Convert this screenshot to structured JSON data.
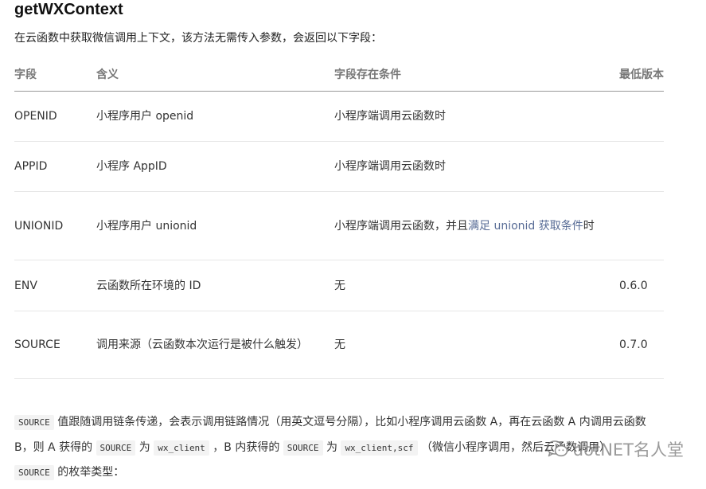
{
  "title": "getWXContext",
  "intro": "在云函数中获取微信调用上下文，该方法无需传入参数，会返回以下字段：",
  "table": {
    "headers": {
      "field": "字段",
      "meaning": "含义",
      "condition": "字段存在条件",
      "min_version": "最低版本"
    },
    "rows": [
      {
        "field": "OPENID",
        "meaning": "小程序用户 openid",
        "condition": "小程序端调用云函数时",
        "min_version": ""
      },
      {
        "field": "APPID",
        "meaning": "小程序 AppID",
        "condition": "小程序端调用云函数时",
        "min_version": ""
      },
      {
        "field": "UNIONID",
        "meaning": "小程序用户 unionid",
        "condition_prefix": "小程序端调用云函数，并且",
        "condition_link": "满足 unionid 获取条件",
        "condition_suffix": "时",
        "min_version": ""
      },
      {
        "field": "ENV",
        "meaning": "云函数所在环境的 ID",
        "condition": "无",
        "min_version": "0.6.0"
      },
      {
        "field": "SOURCE",
        "meaning": "调用来源（云函数本次运行是被什么触发）",
        "condition": "无",
        "min_version": "0.7.0"
      }
    ]
  },
  "paragraph": {
    "line1_code": "SOURCE",
    "line1_text": " 值跟随调用链条传递，会表示调用链路情况（用英文逗号分隔），比如小程序调用云函数 A，再在云函数 A 内调用云函数",
    "line2_text1": "B，则 A 获得的 ",
    "line2_code1": "SOURCE",
    "line2_text2": " 为 ",
    "line2_code2": "wx_client",
    "line2_text3": " ，B 内获得的 ",
    "line2_code3": "SOURCE",
    "line2_text4": " 为 ",
    "line2_code4": "wx_client,scf",
    "line2_text5": " （微信小程序调用，然后云函数调用）",
    "line3_code": "SOURCE",
    "line3_text": " 的枚举类型："
  },
  "watermark": {
    "text": "dotNET名人堂",
    "icon": "wechat-icon"
  }
}
